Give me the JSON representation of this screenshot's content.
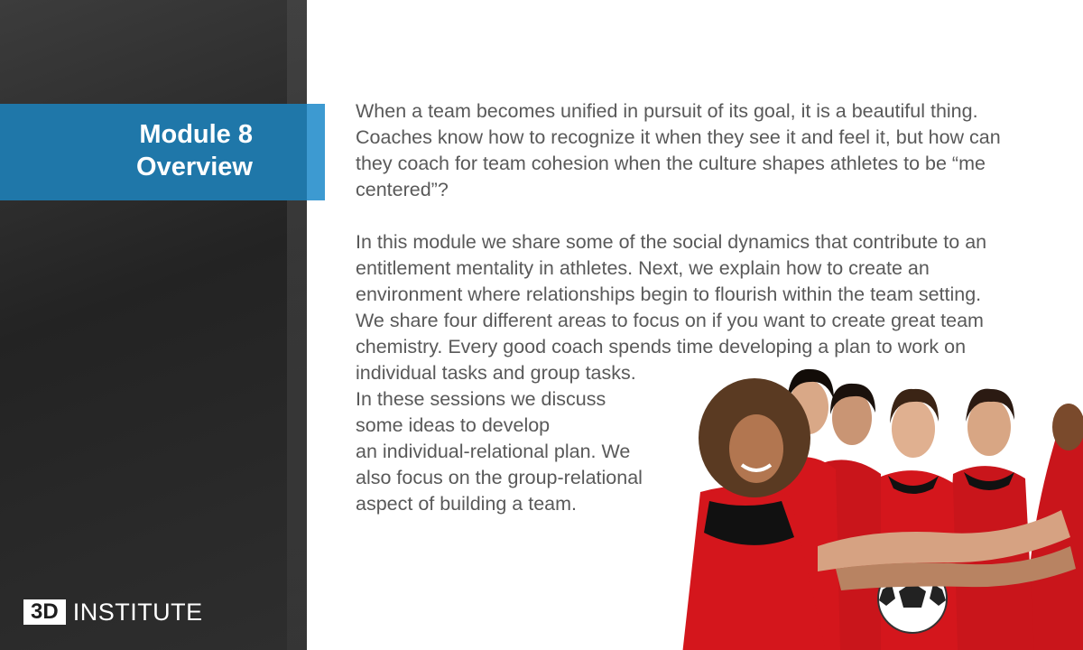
{
  "sidebar": {
    "title_line1": "Module 8",
    "title_line2": "Overview",
    "logo_mark": "3D",
    "logo_text": "INSTITUTE"
  },
  "content": {
    "paragraph1_lines": [
      "When a team becomes unified in pursuit of its goal, it is a beautiful thing.",
      "Coaches know how to recognize it when they see it and feel it, but how can",
      "they coach for team cohesion when the culture shapes athletes to be “me",
      "centered”?"
    ],
    "paragraph2_lines": [
      "In this module we share some of the social dynamics that contribute to an",
      "entitlement mentality in athletes. Next, we explain how to create an",
      "environment where relationships begin to flourish within the team setting.",
      "We share four different areas to focus on if you want to create great team",
      "chemistry. Every good coach spends time developing a plan to work on",
      "individual tasks and group tasks.",
      "In these sessions we discuss",
      "some ideas to develop",
      "an individual-relational plan. We",
      "also focus on the group-relational",
      "aspect of building a team."
    ]
  },
  "colors": {
    "sidebar_bg": "#2b2b2b",
    "title_band": "#1f77a9",
    "title_band_edge": "#3d9ad1",
    "body_text": "#595959",
    "jersey_red": "#d4161c"
  },
  "photo": {
    "description_icon": "team-huddle-photo"
  }
}
